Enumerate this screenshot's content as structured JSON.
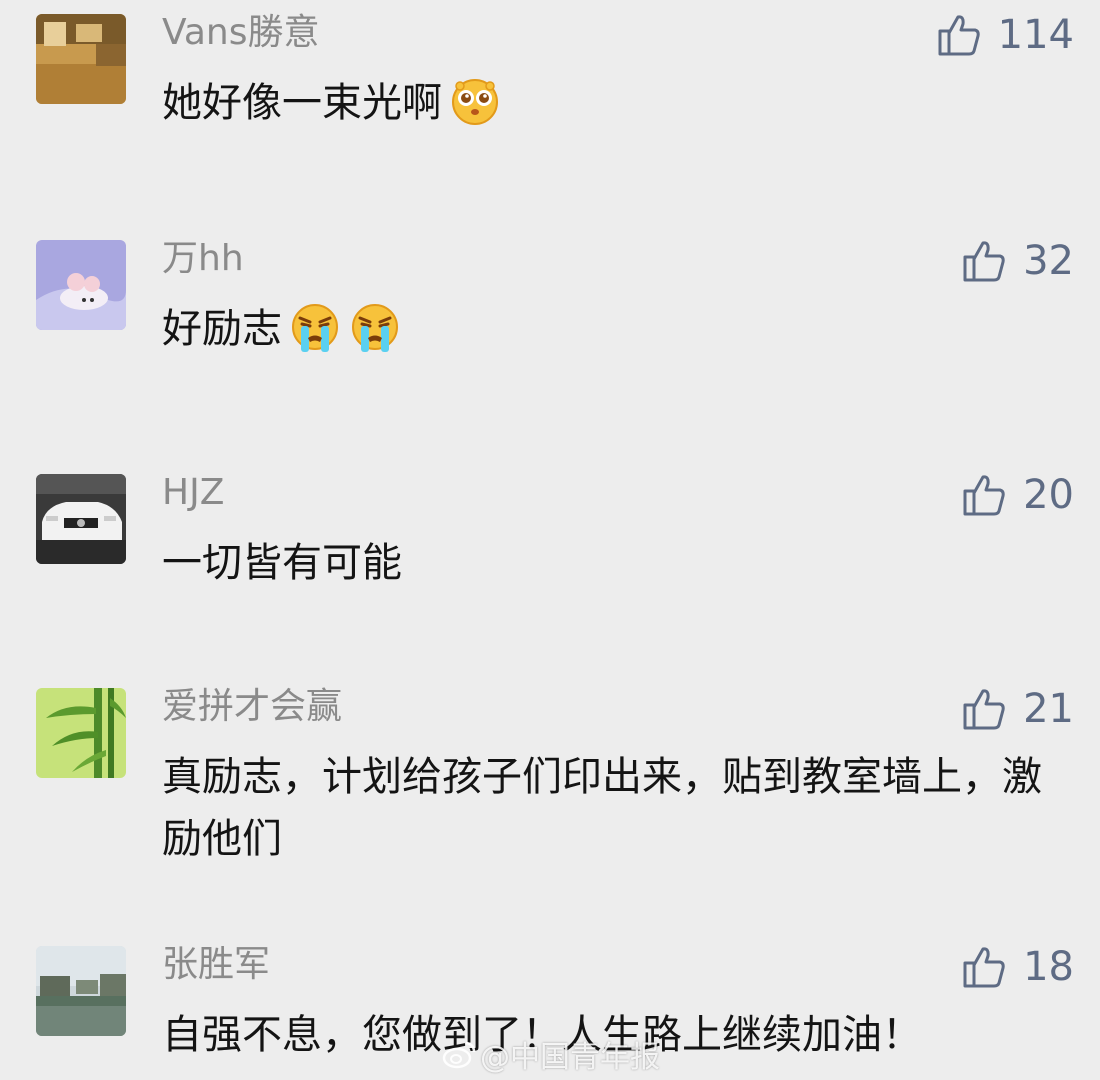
{
  "comments": [
    {
      "username": "Vans勝意",
      "likes": "114",
      "text": "她好像一束光啊",
      "emojis": [
        "star-eyes-emoji"
      ]
    },
    {
      "username": "万hh",
      "likes": "32",
      "text": "好励志",
      "emojis": [
        "crying-emoji",
        "crying-emoji"
      ]
    },
    {
      "username": "HJZ",
      "likes": "20",
      "text": "一切皆有可能",
      "emojis": []
    },
    {
      "username": "爱拼才会赢",
      "likes": "21",
      "text": "真励志，计划给孩子们印出来，贴到教室墙上，激励他们",
      "emojis": []
    },
    {
      "username": "张胜军",
      "likes": "18",
      "text": "自强不息，您做到了！人生路上继续加油！",
      "emojis": []
    }
  ],
  "like_icon": "thumbs-up-icon",
  "watermark": {
    "text": "@中国青年报",
    "icon": "weibo-logo"
  },
  "colors": {
    "background": "#ededed",
    "username": "#8a8a8a",
    "like": "#5e6b84",
    "text": "#141414"
  }
}
